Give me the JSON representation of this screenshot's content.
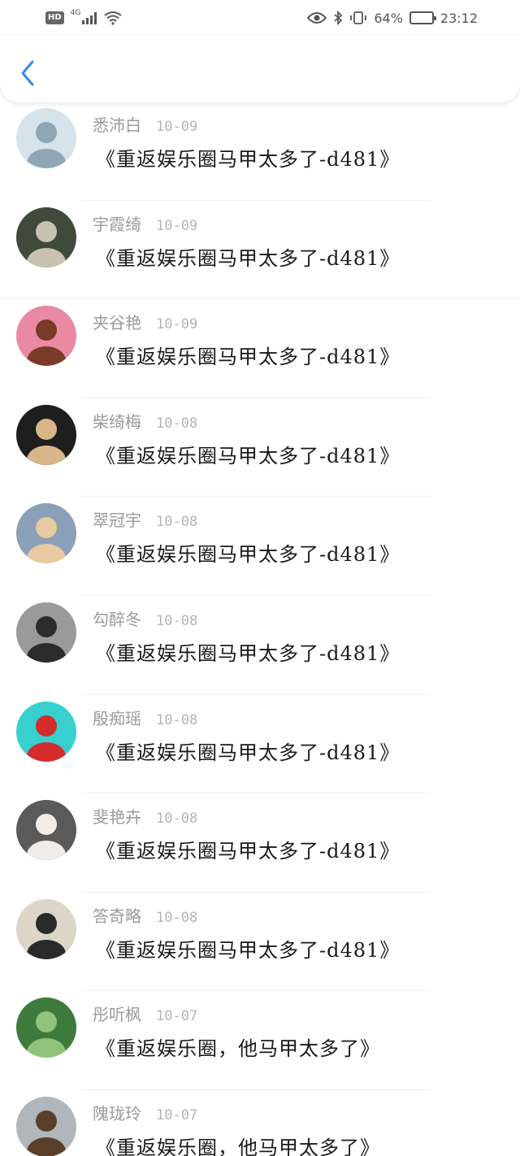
{
  "status": {
    "hd": "HD",
    "network": "4G",
    "battery_pct": "64%",
    "battery_level": 0.64,
    "time": "23:12"
  },
  "nav": {
    "back_icon": "chevron-left-icon",
    "accent": "#2b8ef0"
  },
  "items": [
    {
      "name": "悉沛白",
      "date": "10-09",
      "title": "《重返娱乐圈马甲太多了-d481》",
      "avatar": {
        "bg": "#d7e3ea",
        "fg": "#8ea6b5"
      }
    },
    {
      "name": "宇霞绮",
      "date": "10-09",
      "title": "《重返娱乐圈马甲太多了-d481》",
      "avatar": {
        "bg": "#3f4a3a",
        "fg": "#c9c2b0"
      }
    },
    {
      "name": "夹谷艳",
      "date": "10-09",
      "title": "《重返娱乐圈马甲太多了-d481》",
      "avatar": {
        "bg": "#e98aa5",
        "fg": "#7a3a2a"
      }
    },
    {
      "name": "柴绮梅",
      "date": "10-08",
      "title": "《重返娱乐圈马甲太多了-d481》",
      "avatar": {
        "bg": "#1e1e1e",
        "fg": "#d9b58a"
      }
    },
    {
      "name": "翠冠宇",
      "date": "10-08",
      "title": "《重返娱乐圈马甲太多了-d481》",
      "avatar": {
        "bg": "#8aa0b8",
        "fg": "#e8c9a0"
      }
    },
    {
      "name": "勾醉冬",
      "date": "10-08",
      "title": "《重返娱乐圈马甲太多了-d481》",
      "avatar": {
        "bg": "#9a9a9a",
        "fg": "#2c2c2c"
      }
    },
    {
      "name": "殷痴瑶",
      "date": "10-08",
      "title": "《重返娱乐圈马甲太多了-d481》",
      "avatar": {
        "bg": "#38d0cf",
        "fg": "#d42b2b"
      }
    },
    {
      "name": "斐艳卉",
      "date": "10-08",
      "title": "《重返娱乐圈马甲太多了-d481》",
      "avatar": {
        "bg": "#5a5a5a",
        "fg": "#f1ece7"
      }
    },
    {
      "name": "答奇略",
      "date": "10-08",
      "title": "《重返娱乐圈马甲太多了-d481》",
      "avatar": {
        "bg": "#ddd6c8",
        "fg": "#2a2a2a"
      }
    },
    {
      "name": "彤听枫",
      "date": "10-07",
      "title": "《重返娱乐圈，他马甲太多了》",
      "avatar": {
        "bg": "#3e7a3c",
        "fg": "#8fc27a"
      }
    },
    {
      "name": "隗珑玲",
      "date": "10-07",
      "title": "《重返娱乐圈，他马甲太多了》",
      "avatar": {
        "bg": "#b0b6bc",
        "fg": "#5a3f2a"
      }
    }
  ]
}
